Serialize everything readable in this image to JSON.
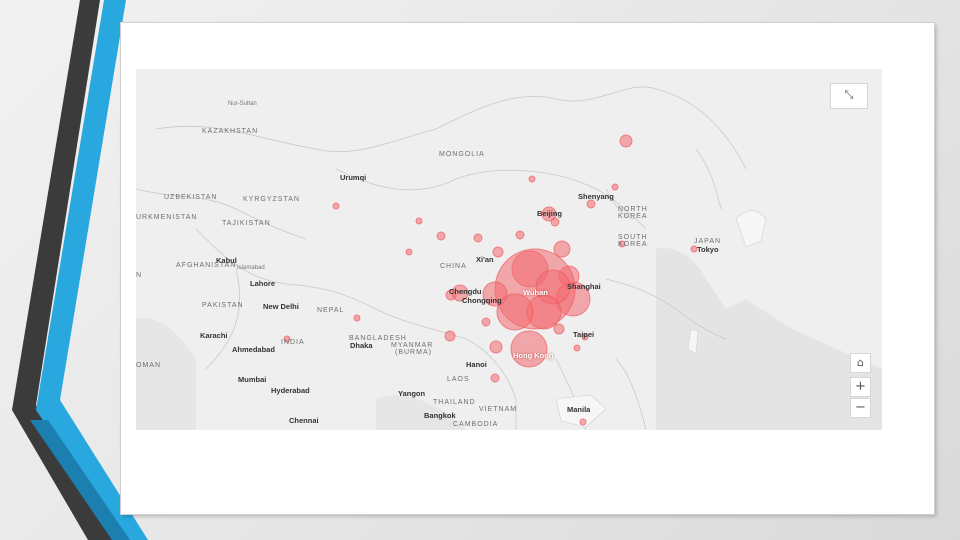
{
  "theme": {
    "accent_blue": "#29a8e0",
    "dark_bar": "#3b3b3b",
    "bubble_color": "#f26a6f"
  },
  "map": {
    "labels": [
      {
        "text": "Nur-Sultan",
        "kind": "small",
        "name": "label-nur-sultan"
      },
      {
        "text": "KAZAKHSTAN",
        "kind": "country",
        "name": "label-kazakhstan"
      },
      {
        "text": "MONGOLIA",
        "kind": "country",
        "name": "label-mongolia"
      },
      {
        "text": "Urumqi",
        "kind": "city",
        "name": "label-urumqi"
      },
      {
        "text": "UZBEKISTAN",
        "kind": "country",
        "name": "label-uzbekistan"
      },
      {
        "text": "KYRGYZSTAN",
        "kind": "country",
        "name": "label-kyrgyzstan"
      },
      {
        "text": "URKMENISTAN",
        "kind": "country",
        "name": "label-turkmenistan"
      },
      {
        "text": "TAJIKISTAN",
        "kind": "country",
        "name": "label-tajikistan"
      },
      {
        "text": "Kabul",
        "kind": "city",
        "name": "label-kabul"
      },
      {
        "text": "AFGHANISTAN",
        "kind": "country",
        "name": "label-afghanistan"
      },
      {
        "text": "Islamabad",
        "kind": "small",
        "name": "label-islamabad"
      },
      {
        "text": "Lahore",
        "kind": "city",
        "name": "label-lahore"
      },
      {
        "text": "PAKISTAN",
        "kind": "country",
        "name": "label-pakistan"
      },
      {
        "text": "New Delhi",
        "kind": "city",
        "name": "label-new-delhi"
      },
      {
        "text": "NEPAL",
        "kind": "country",
        "name": "label-nepal"
      },
      {
        "text": "Karachi",
        "kind": "city",
        "name": "label-karachi"
      },
      {
        "text": "INDIA",
        "kind": "country",
        "name": "label-india"
      },
      {
        "text": "Ahmedabad",
        "kind": "city",
        "name": "label-ahmedabad"
      },
      {
        "text": "OMAN",
        "kind": "country",
        "name": "label-oman"
      },
      {
        "text": "Mumbai",
        "kind": "city",
        "name": "label-mumbai"
      },
      {
        "text": "Hyderabad",
        "kind": "city",
        "name": "label-hyderabad"
      },
      {
        "text": "Chennai",
        "kind": "city",
        "name": "label-chennai"
      },
      {
        "text": "BANGLADESH",
        "kind": "country",
        "name": "label-bangladesh"
      },
      {
        "text": "Dhaka",
        "kind": "city",
        "name": "label-dhaka"
      },
      {
        "text": "MYANMAR",
        "kind": "country",
        "name": "label-myanmar"
      },
      {
        "text": "(BURMA)",
        "kind": "country",
        "name": "label-burma"
      },
      {
        "text": "Yangon",
        "kind": "city",
        "name": "label-yangon"
      },
      {
        "text": "THAILAND",
        "kind": "country",
        "name": "label-thailand"
      },
      {
        "text": "Bangkok",
        "kind": "city",
        "name": "label-bangkok"
      },
      {
        "text": "LAOS",
        "kind": "country",
        "name": "label-laos"
      },
      {
        "text": "VIETNAM",
        "kind": "country",
        "name": "label-vietnam"
      },
      {
        "text": "CAMBODIA",
        "kind": "country",
        "name": "label-cambodia"
      },
      {
        "text": "Hanoi",
        "kind": "city",
        "name": "label-hanoi"
      },
      {
        "text": "CHINA",
        "kind": "country",
        "name": "label-china"
      },
      {
        "text": "Xi'an",
        "kind": "city",
        "name": "label-xian"
      },
      {
        "text": "Chengdu",
        "kind": "city",
        "name": "label-chengdu"
      },
      {
        "text": "Chongqing",
        "kind": "city",
        "name": "label-chongqing"
      },
      {
        "text": "Wuhan",
        "kind": "cityw",
        "name": "label-wuhan"
      },
      {
        "text": "Shanghai",
        "kind": "city",
        "name": "label-shanghai"
      },
      {
        "text": "Hong Kong",
        "kind": "cityw",
        "name": "label-hong-kong"
      },
      {
        "text": "Taipei",
        "kind": "city",
        "name": "label-taipei"
      },
      {
        "text": "Manila",
        "kind": "city",
        "name": "label-manila"
      },
      {
        "text": "Beijing",
        "kind": "city",
        "name": "label-beijing"
      },
      {
        "text": "Shenyang",
        "kind": "city",
        "name": "label-shenyang"
      },
      {
        "text": "NORTH",
        "kind": "country",
        "name": "label-north"
      },
      {
        "text": "KOREA",
        "kind": "country",
        "name": "label-north-korea"
      },
      {
        "text": "SOUTH",
        "kind": "country",
        "name": "label-south"
      },
      {
        "text": "KOREA",
        "kind": "country",
        "name": "label-south-korea"
      },
      {
        "text": "JAPAN",
        "kind": "country",
        "name": "label-japan"
      },
      {
        "text": "Tokyo",
        "kind": "city",
        "name": "label-tokyo"
      },
      {
        "text": "N",
        "kind": "country",
        "name": "label-n-edge"
      }
    ],
    "controls": {
      "expand": "⤡",
      "home": "⌂",
      "zoom_in": "+",
      "zoom_out": "−"
    }
  }
}
